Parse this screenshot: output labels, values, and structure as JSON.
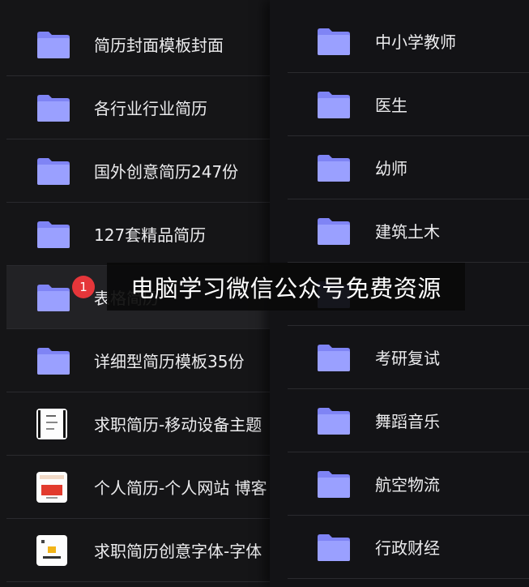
{
  "left_list": [
    {
      "label": "简历封面模板封面",
      "icon": "folder-icon"
    },
    {
      "label": "各行业行业简历",
      "icon": "folder-icon"
    },
    {
      "label": "国外创意简历247份",
      "icon": "folder-icon"
    },
    {
      "label": "127套精品简历",
      "icon": "folder-icon"
    },
    {
      "label": "表格简历",
      "icon": "folder-icon"
    },
    {
      "label": "详细型简历模板35份",
      "icon": "folder-icon"
    },
    {
      "label": "求职简历-移动设备主题",
      "icon": "document-thumbnail-icon"
    },
    {
      "label": "个人简历-个人网站 博客",
      "icon": "document-thumbnail-icon"
    },
    {
      "label": "求职简历创意字体-字体",
      "icon": "document-thumbnail-icon"
    }
  ],
  "right_list": [
    {
      "label": "中小学教师",
      "icon": "folder-icon"
    },
    {
      "label": "医生",
      "icon": "folder-icon"
    },
    {
      "label": "幼师",
      "icon": "folder-icon"
    },
    {
      "label": "建筑土木",
      "icon": "folder-icon"
    },
    {
      "label": "",
      "icon": "folder-icon"
    },
    {
      "label": "考研复试",
      "icon": "folder-icon"
    },
    {
      "label": "舞蹈音乐",
      "icon": "folder-icon"
    },
    {
      "label": "航空物流",
      "icon": "folder-icon"
    },
    {
      "label": "行政财经",
      "icon": "folder-icon"
    }
  ],
  "badge": {
    "count": "1"
  },
  "watermark": {
    "text": "电脑学习微信公众号免费资源"
  },
  "colors": {
    "folder": "#8f95ff",
    "badge": "#e5363a",
    "background": "#111113"
  }
}
